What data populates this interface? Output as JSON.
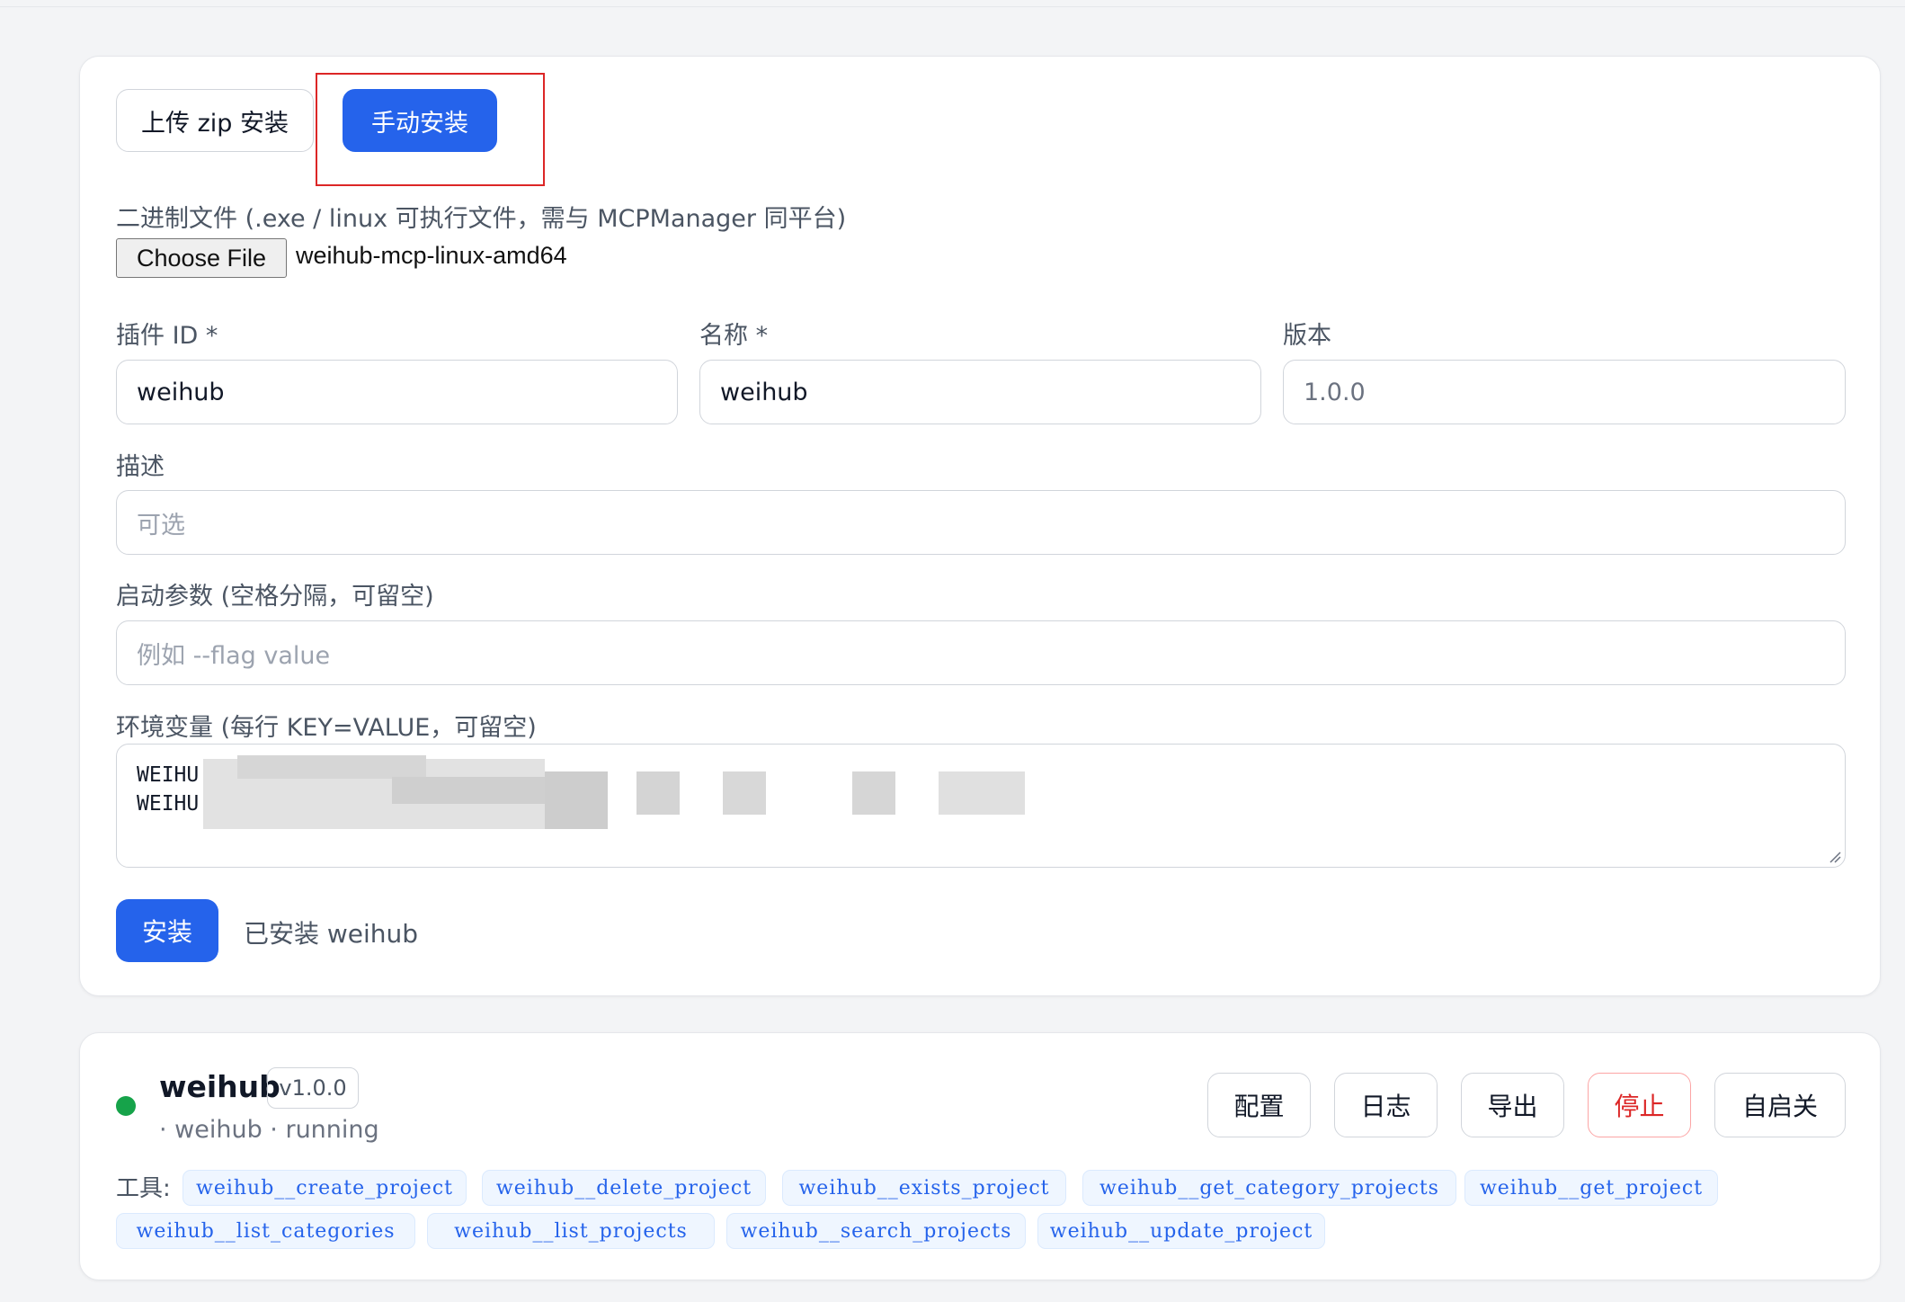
{
  "tabs": {
    "upload_zip": "上传 zip 安装",
    "manual": "手动安装"
  },
  "binary": {
    "label": "二进制文件 (.exe / linux 可执行文件，需与 MCPManager 同平台)",
    "choose_button": "Choose File",
    "file_name": "weihub-mcp-linux-amd64"
  },
  "fields": {
    "plugin_id_label": "插件 ID *",
    "plugin_id_value": "weihub",
    "name_label": "名称 *",
    "name_value": "weihub",
    "version_label": "版本",
    "version_value": "1.0.0",
    "description_label": "描述",
    "description_placeholder": "可选",
    "args_label": "启动参数 (空格分隔，可留空)",
    "args_placeholder": "例如 --flag value",
    "env_label": "环境变量 (每行 KEY=VALUE，可留空)",
    "env_lines": [
      "WEIHU",
      "WEIHU"
    ]
  },
  "install": {
    "button": "安装",
    "status": "已安装 weihub"
  },
  "plugin": {
    "status_color": "#16a34a",
    "name": "weihub",
    "version": "v1.0.0",
    "subtitle": "· weihub · running",
    "actions": {
      "config": "配置",
      "logs": "日志",
      "export": "导出",
      "stop": "停止",
      "autostart": "自启关"
    },
    "tools_label": "工具:",
    "tools": [
      "weihub__create_project",
      "weihub__delete_project",
      "weihub__exists_project",
      "weihub__get_category_projects",
      "weihub__get_project",
      "weihub__list_categories",
      "weihub__list_projects",
      "weihub__search_projects",
      "weihub__update_project"
    ]
  },
  "colors": {
    "primary": "#2563eb",
    "danger": "#dc2626",
    "highlight": "#dc2626"
  }
}
